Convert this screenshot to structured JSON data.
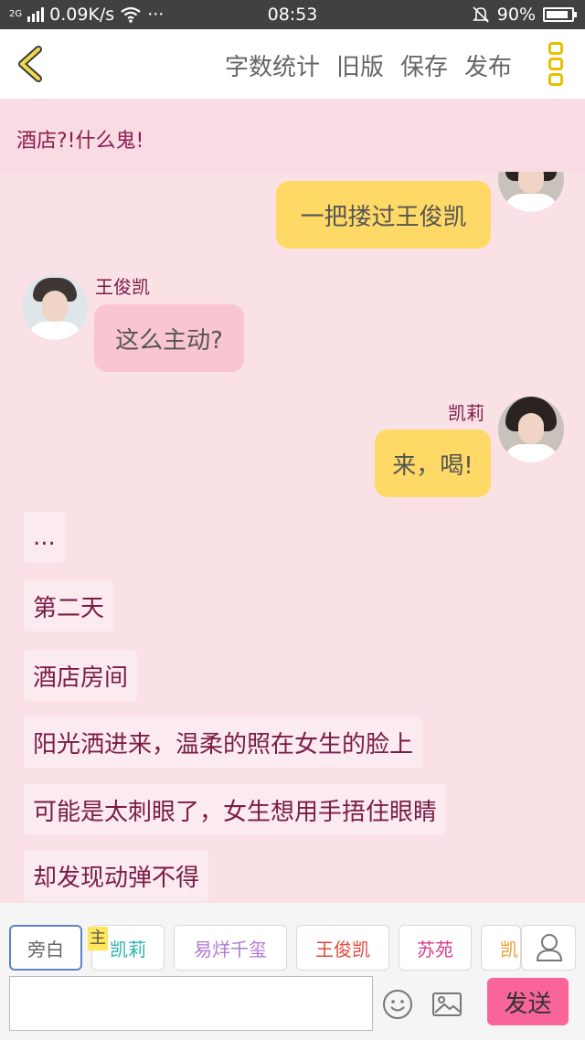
{
  "status_bar": {
    "network": "2G",
    "speed": "0.09K/s",
    "dots": "···",
    "time": "08:53",
    "battery": "90%",
    "battery_level": 0.9
  },
  "toolbar": {
    "actions": [
      "字数统计",
      "旧版",
      "保存",
      "发布"
    ]
  },
  "messages": {
    "narration_top": "酒店?!什么鬼!",
    "m1_text": "一把搂过王俊凯",
    "m2_name": "王俊凯",
    "m2_text": "这么主动?",
    "m3_name": "凯莉",
    "m3_text": "来，喝!",
    "narrations": [
      "...",
      "第二天",
      "酒店房间",
      "阳光洒进来，温柔的照在女生的脸上",
      "可能是太刺眼了，女生想用手捂住眼睛",
      "却发现动弹不得"
    ]
  },
  "characters": {
    "tag": "主",
    "chips": [
      {
        "label": "旁白",
        "color": "#666666"
      },
      {
        "label": "凯莉",
        "color": "#2bb3a8"
      },
      {
        "label": "易烊千玺",
        "color": "#b07ad6"
      },
      {
        "label": "王俊凯",
        "color": "#e04a3a"
      },
      {
        "label": "苏苑",
        "color": "#d43b8a"
      },
      {
        "label": "凯",
        "color": "#e8a03c"
      }
    ]
  },
  "composer": {
    "placeholder": "",
    "send_label": "发送",
    "icons": [
      "emoji-icon",
      "image-icon",
      "person-icon"
    ]
  }
}
